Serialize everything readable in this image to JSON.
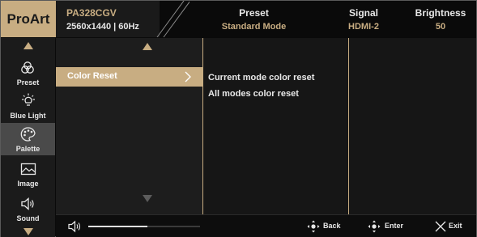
{
  "header": {
    "brand": "ProArt",
    "model": "PA328CGV",
    "resolution": "2560x1440 | 60Hz",
    "stats": [
      {
        "key": "Preset",
        "value": "Standard Mode"
      },
      {
        "key": "Signal",
        "value": "HDMI-2"
      },
      {
        "key": "Brightness",
        "value": "50"
      }
    ]
  },
  "nav": {
    "items": [
      {
        "label": "Preset",
        "icon": "preset-icon"
      },
      {
        "label": "Blue Light",
        "icon": "blue-light-icon"
      },
      {
        "label": "Palette",
        "icon": "palette-icon",
        "active": true
      },
      {
        "label": "Image",
        "icon": "image-icon"
      },
      {
        "label": "Sound",
        "icon": "sound-icon"
      }
    ]
  },
  "menu": {
    "selected": "Color Reset",
    "options": [
      "Current mode color reset",
      "All modes color reset"
    ]
  },
  "footer": {
    "volume_fraction": 0.53,
    "back": "Back",
    "enter": "Enter",
    "exit": "Exit"
  },
  "colors": {
    "accent": "#c8ad82",
    "background": "#0a0a0a",
    "active_item": "#4a4a4a"
  }
}
